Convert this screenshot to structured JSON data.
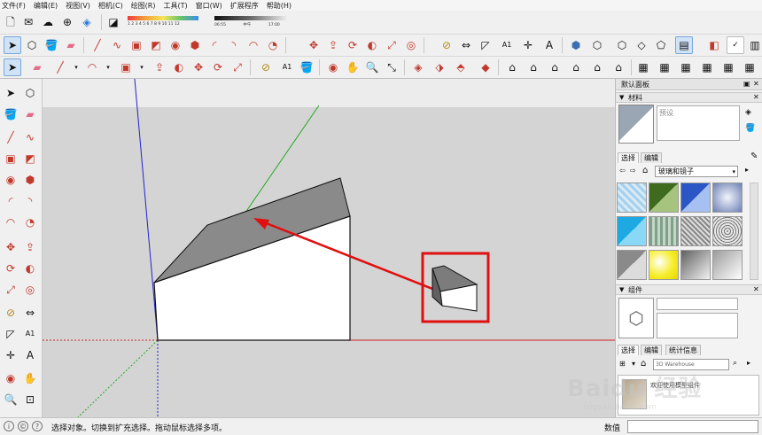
{
  "menu": [
    "文件(F)",
    "编辑(E)",
    "视图(V)",
    "相机(C)",
    "绘图(R)",
    "工具(T)",
    "窗口(W)",
    "扩展程序",
    "帮助(H)"
  ],
  "toolbar": {
    "timeline_a": "1 2 3 4 5 6 7 8 9 10 11 12",
    "timeline_b": "06:55 中午 17:00"
  },
  "panel": {
    "title": "默认面板",
    "materials_header": "材料",
    "preset_placeholder": "预设",
    "select_tab": "选择",
    "edit_tab": "编辑",
    "library_dropdown": "玻璃和镜子",
    "components_header": "组件",
    "comp_select_tab": "选择",
    "comp_edit_tab": "编辑",
    "comp_stats_tab": "统计信息",
    "search_placeholder": "3D Warehouse",
    "result_label": "欢迎使用模型组件"
  },
  "status": {
    "message": "选择对象。切换到扩充选择。拖动鼠标选择多项。",
    "measurements_label": "数值"
  },
  "watermark": "Baidu 经验",
  "watermark_sub": "jingyan.baidu.com",
  "colors": {
    "highlight_red": "#e01010",
    "axis_red": "#cc2222",
    "axis_green": "#22aa22",
    "axis_blue": "#2222cc",
    "viewport_bg": "#d4d4d4",
    "face_gray": "#8a8a8a",
    "face_white": "#ffffff"
  }
}
